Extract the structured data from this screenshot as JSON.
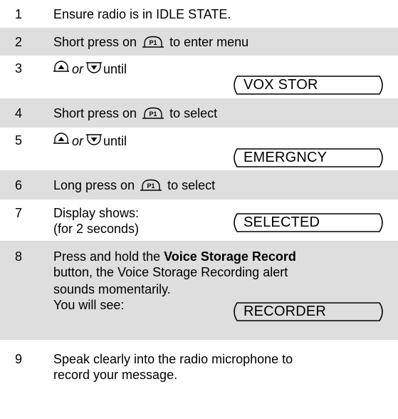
{
  "steps": [
    {
      "num": "1",
      "text": "Ensure radio is in IDLE STATE."
    },
    {
      "num": "2",
      "before": "Short press on",
      "button": "P1",
      "after": "to enter menu"
    },
    {
      "num": "3",
      "or": "or",
      "until": "until",
      "display": "VOX STOR"
    },
    {
      "num": "4",
      "before": "Short press on",
      "button": "P1",
      "after": "to select"
    },
    {
      "num": "5",
      "or": "or",
      "until": "until",
      "display": "EMERGNCY"
    },
    {
      "num": "6",
      "before": "Long press on",
      "button": "P1",
      "after": "to select"
    },
    {
      "num": "7",
      "line1": "Display shows:",
      "line2": "(for 2 seconds)",
      "display": "SELECTED"
    },
    {
      "num": "8",
      "line1_before": "Press and hold the",
      "line1_bold": "Voice Storage Record",
      "line2": "button, the Voice Storage Recording alert",
      "line3": "sounds momentarily.",
      "line4": "You will see:",
      "display": "RECORDER"
    },
    {
      "num": "9",
      "line1": "Speak clearly into the radio microphone to",
      "line2": "record your message."
    }
  ],
  "colors": {
    "shade": "#dedede",
    "text": "#000000"
  },
  "icons": {
    "up": "up-arrow-icon",
    "down": "down-arrow-icon",
    "p1": "p1-button-icon"
  }
}
